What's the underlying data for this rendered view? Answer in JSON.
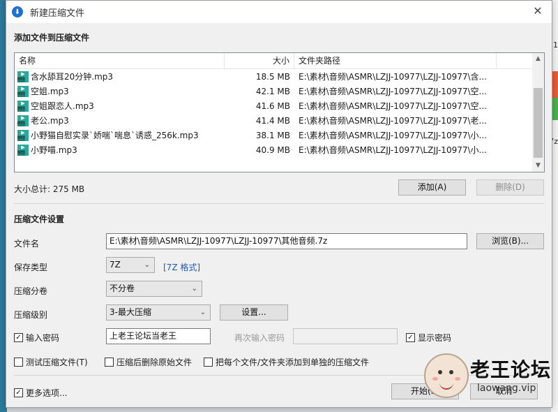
{
  "window": {
    "title": "新建压缩文件"
  },
  "files_section": {
    "title": "添加文件到压缩文件"
  },
  "file_list": {
    "headers": {
      "name": "名称",
      "size": "大小",
      "path": "文件夹路径"
    },
    "rows": [
      {
        "icon": "mp3-file-icon",
        "icon_label": "MP3",
        "name": "含水舔耳20分钟.mp3",
        "size": "18.5 MB",
        "path": "E:\\素材\\音频\\ASMR\\LZJJ-10977\\LZJJ-10977\\含..."
      },
      {
        "icon": "mp3-file-icon",
        "icon_label": "MP3",
        "name": "空姐.mp3",
        "size": "42.1 MB",
        "path": "E:\\素材\\音频\\ASMR\\LZJJ-10977\\LZJJ-10977\\空..."
      },
      {
        "icon": "mp3-file-icon",
        "icon_label": "MP3",
        "name": "空姐跟恋人.mp3",
        "size": "41.6 MB",
        "path": "E:\\素材\\音频\\ASMR\\LZJJ-10977\\LZJJ-10977\\空..."
      },
      {
        "icon": "mp3-file-icon",
        "icon_label": "MP3",
        "name": "老公.mp3",
        "size": "41.4 MB",
        "path": "E:\\素材\\音频\\ASMR\\LZJJ-10977\\LZJJ-10977\\老..."
      },
      {
        "icon": "mp3-file-icon",
        "icon_label": "MP3",
        "name": "小野猫自慰实录`娇喘`喘息`诱惑_256k.mp3",
        "size": "38.1 MB",
        "path": "E:\\素材\\音频\\ASMR\\LZJJ-10977\\LZJJ-10977\\小..."
      },
      {
        "icon": "mp3-file-icon",
        "icon_label": "MP3",
        "name": "小野喵.mp3",
        "size": "40.9 MB",
        "path": "E:\\素材\\音频\\ASMR\\LZJJ-10977\\LZJJ-10977\\小..."
      }
    ]
  },
  "summary": {
    "total_label": "大小总计: 275 MB"
  },
  "buttons": {
    "add": "添加(A)",
    "delete": "删除(D)",
    "browse": "浏览(B)...",
    "settings": "设置...",
    "start": "开始(S)",
    "cancel": "取消"
  },
  "settings_section": {
    "title": "压缩文件设置",
    "filename_label": "文件名",
    "filename_value": "E:\\素材\\音频\\ASMR\\LZJJ-10977\\LZJJ-10977\\其他音频.7z",
    "type_label": "保存类型",
    "type_value": "7Z",
    "type_link": "[7Z 格式]",
    "split_label": "压缩分卷",
    "split_value": "不分卷",
    "level_label": "压缩级别",
    "level_value": "3-最大压缩"
  },
  "password": {
    "enable_label": "输入密码",
    "enable_checked": true,
    "value": "上老王论坛当老王",
    "reenter_label": "再次输入密码",
    "show_label": "显示密码",
    "show_checked": true
  },
  "options": {
    "test_label": "测试压缩文件(T)",
    "test_checked": false,
    "delete_label": "压缩后删除原始文件",
    "delete_checked": false,
    "separate_label": "把每个文件/文件夹添加到单独的压缩文件",
    "separate_checked": false,
    "more_label": "更多选项...",
    "more_checked": true
  },
  "background": {
    "right_text_1": "1",
    "right_text_2": "7z"
  },
  "watermark": {
    "title": "老王论坛",
    "url": "laowang.vip"
  }
}
